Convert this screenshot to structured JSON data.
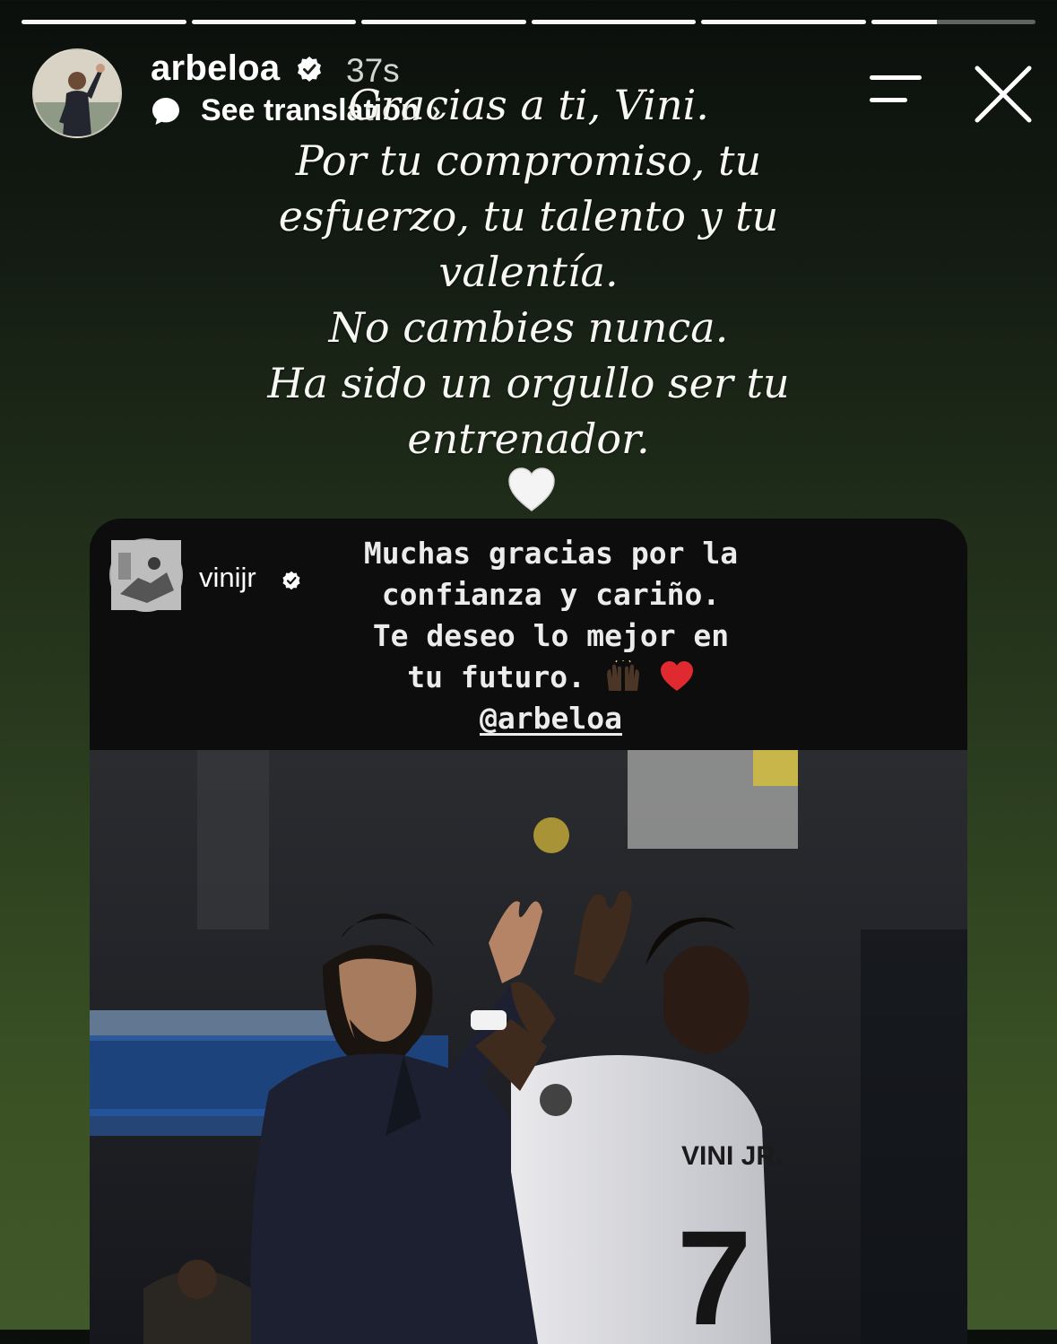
{
  "story": {
    "segments_total": 6,
    "current_segment": 6,
    "current_progress": 0.4
  },
  "header": {
    "username": "arbeloa",
    "timestamp": "37s",
    "translation_label": "See translation",
    "icons": [
      "verified-badge",
      "translate-bubble-icon",
      "menu-icon",
      "close-icon"
    ]
  },
  "caption": {
    "lines": [
      "Gracias a ti, Vini.",
      "Por tu compromiso, tu",
      "esfuerzo, tu talento y tu",
      "valentía.",
      "No cambies nunca.",
      "Ha sido un orgullo ser tu",
      "entrenador."
    ],
    "emoji": "white-heart"
  },
  "shared_story": {
    "username": "vinijr",
    "text_lines": [
      "Muchas gracias por la",
      "confianza y cariño.",
      "Te deseo lo mejor en",
      "tu futuro."
    ],
    "emojis": [
      "raising-hands",
      "red-heart"
    ],
    "mention": "@arbeloa",
    "photo": {
      "jersey_name": "VINI JR.",
      "jersey_number": "7"
    }
  },
  "colors": {
    "background_top": "#0b0f0c",
    "background_bottom": "#41592a",
    "text": "#ffffff"
  }
}
